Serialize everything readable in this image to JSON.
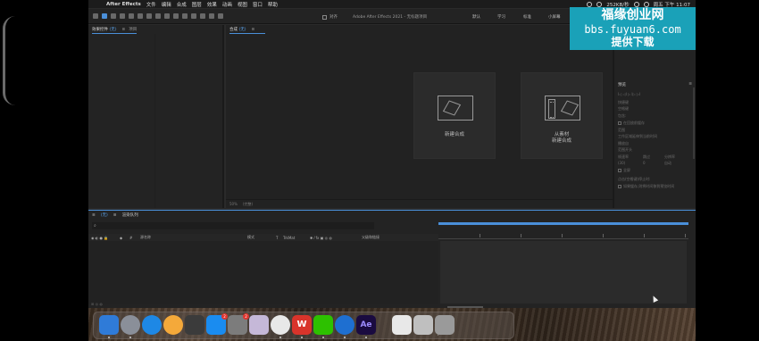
{
  "menubar": {
    "app_name": "After Effects",
    "menus": [
      "文件",
      "编辑",
      "合成",
      "图层",
      "效果",
      "动画",
      "视图",
      "窗口",
      "帮助"
    ],
    "status_network": "252KB/秒",
    "clock": "周五 下午 11:07"
  },
  "toolbar": {
    "window_title": "Adobe After Effects 2021 - 无标题项目",
    "align_label": "对齐",
    "workspaces": [
      "默认",
      "学习",
      "标准",
      "小屏幕"
    ]
  },
  "left_panel": {
    "tab_effects_prefix": "效果控件",
    "tab_effects_hl": "(无)",
    "tab_project": "项目"
  },
  "comp_panel": {
    "tab_label": "合成",
    "tab_hl": "(无)",
    "new_comp_label": "新建合成",
    "from_footage_line1": "从素材",
    "from_footage_line2": "新建合成",
    "zoom_value": "50%",
    "resolution": "(完整)"
  },
  "right_panel": {
    "section_title": "预览",
    "shortcut_label": "快捷键",
    "shortcut_value": "空格键",
    "include_label": "包含:",
    "cache_label": "在回放前缓存",
    "range_label": "范围",
    "range_value": "工作区域延伸到当前时间",
    "play_from_label": "播放自",
    "play_from_value": "范围开头",
    "fps_label": "帧速率",
    "skip_label": "跳过",
    "res_label": "分辨率",
    "fps_value": "(30)",
    "skip_value": "0",
    "res_value": "自动",
    "fullscreen_label": "全屏",
    "stop_label": "点击(空格键)停止时:",
    "stop_option": "如果缓存,则将时间移到预览时间"
  },
  "timeline": {
    "tab_hl": "(无)",
    "tab_render": "渲染队列",
    "search_placeholder": "⌕",
    "col_source": "源名称",
    "col_mode": "模式",
    "col_t": "T",
    "col_trkmat": "TrkMat",
    "col_parent": "父级和链接"
  },
  "dock": {
    "items": [
      {
        "name": "finder",
        "color": "#2f7bd8"
      },
      {
        "name": "launchpad",
        "color": "#8a8f99"
      },
      {
        "name": "safari",
        "color": "#1e88e5"
      },
      {
        "name": "photos",
        "color": "#f4a93a"
      },
      {
        "name": "final-cut",
        "color": "#3b3b3b"
      },
      {
        "name": "app-store",
        "color": "#1a8cf0"
      },
      {
        "name": "system-preferences",
        "color": "#7c7c7c"
      },
      {
        "name": "calendar",
        "color": "#c5b8d8"
      },
      {
        "name": "chrome",
        "color": "#e8e8e8"
      },
      {
        "name": "wps",
        "color": "#d9342b"
      },
      {
        "name": "wechat",
        "color": "#2dc100"
      },
      {
        "name": "edge",
        "color": "#1e6fd1"
      },
      {
        "name": "after-effects",
        "color": "#1a0b40"
      },
      {
        "name": "screenshot",
        "color": "#e8e8e8"
      },
      {
        "name": "preview",
        "color": "#bfbfbf"
      },
      {
        "name": "trash",
        "color": "#9a9a9a"
      }
    ],
    "app_store_badge": "2",
    "sysprefs_badge": "2",
    "ae_label": "Ae",
    "wps_label": "W"
  },
  "watermark": {
    "line1": "福缘创业网",
    "line2": "bbs.fuyuan6.com",
    "line3": "提供下载"
  }
}
